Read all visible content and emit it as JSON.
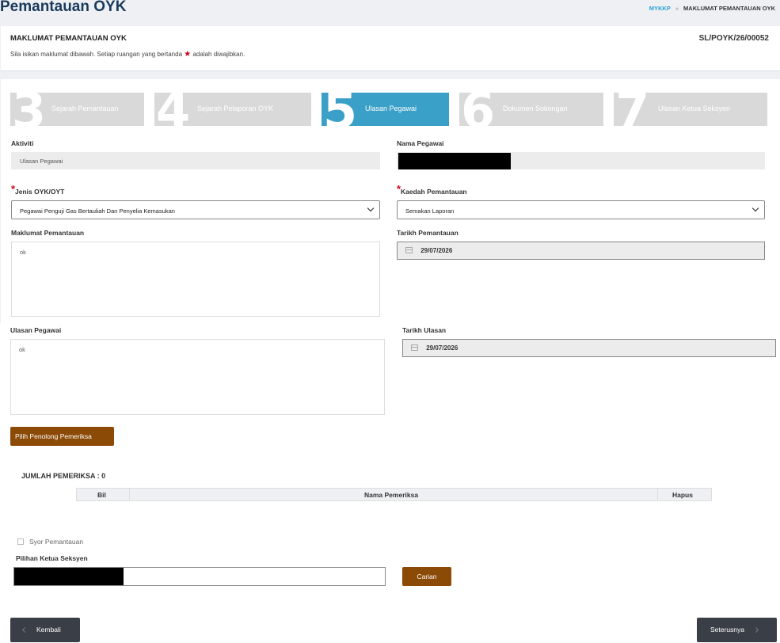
{
  "page": {
    "title": "Pemantauan OYK",
    "breadcrumb": {
      "home": "MYKKP",
      "current": "MAKLUMAT PEMANTAUAN OYK"
    }
  },
  "header": {
    "title": "MAKLUMAT PEMANTAUAN OYK",
    "reference": "SL/POYK/26/00052",
    "note_before": "Sila isikan maklumat dibawah. Setiap ruangan yang bertanda",
    "note_after": "adalah diwajibkan."
  },
  "wizard": {
    "steps": [
      {
        "number": "3",
        "label": "Sejarah Pemantauan"
      },
      {
        "number": "4",
        "label": "Sejarah Pelaporan OYK"
      },
      {
        "number": "5",
        "label": "Ulasan Pegawai"
      },
      {
        "number": "6",
        "label": "Dokumen Sokongan"
      },
      {
        "number": "7",
        "label": "Ulasan Ketua Seksyen"
      }
    ],
    "active": "Ulasan Pegawai"
  },
  "form": {
    "aktiviti": {
      "label": "Aktiviti",
      "value": "Ulasan Pegawai"
    },
    "nama_pegawai": {
      "label": "Nama Pegawai"
    },
    "jenis": {
      "label": "Jenis OYK/OYT",
      "value": "Pegawai Penguji Gas Bertauliah Dan Penyelia Kemasukan"
    },
    "kaedah": {
      "label": "Kaedah Pemantauan",
      "value": "Semakan Laporan"
    },
    "maklumat": {
      "label": "Maklumat Pemantauan",
      "value": "ok"
    },
    "tarikh_pemantauan": {
      "label": "Tarikh Pemantauan",
      "value": "29/07/2026"
    },
    "ulasan": {
      "label": "Ulasan Pegawai",
      "value": "ok"
    },
    "tarikh_ulasan": {
      "label": "Tarikh Ulasan",
      "value": "29/07/2026"
    }
  },
  "pemeriksa": {
    "button": "Pilih Penolong Pemeriksa",
    "count_label": "JUMLAH PEMERIKSA : 0",
    "columns": [
      "Bil",
      "Nama Pemeriksa",
      "Hapus"
    ]
  },
  "syor": {
    "checkbox_label": "Syor Pemantauan",
    "ketua_label": "Pilihan Ketua Seksyen",
    "search_button": "Carian"
  },
  "footer": {
    "back": "Kembali",
    "next": "Seterusnya"
  },
  "colors": {
    "accent": "#3aa0c8",
    "brown": "#8b4a06",
    "dark": "#3a3f47",
    "required": "#d0021b"
  }
}
